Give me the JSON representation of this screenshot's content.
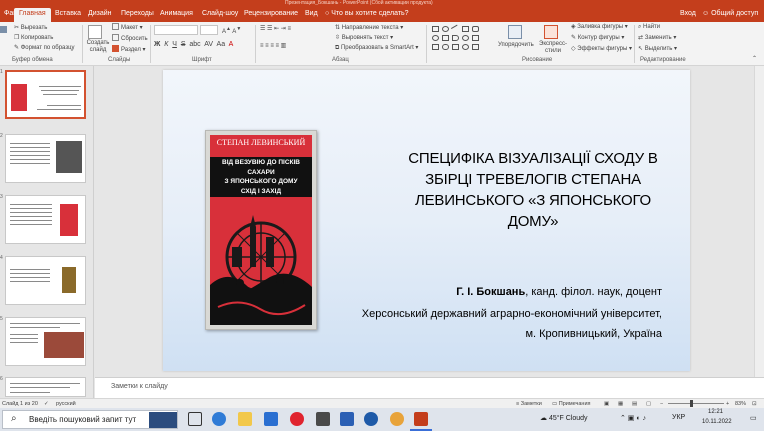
{
  "window": {
    "title": "Презентация_Бокшань - PowerPoint (Сбой активации продукта)"
  },
  "tabs": [
    "Файл",
    "Главная",
    "Вставка",
    "Дизайн",
    "Переходы",
    "Анимация",
    "Слайд-шоу",
    "Рецензирование",
    "Вид"
  ],
  "tell_me": "Что вы хотите сделать?",
  "account": {
    "signin": "Вход",
    "share": "Общий доступ"
  },
  "ribbon": {
    "clipboard": {
      "paste": "Вставить",
      "cut": "Вырезать",
      "copy": "Копировать",
      "format_painter": "Формат по образцу",
      "label": "Буфер обмена"
    },
    "slides": {
      "new_slide": "Создать слайд",
      "layout": "Макет",
      "reset": "Сбросить",
      "section": "Раздел",
      "label": "Слайды"
    },
    "font": {
      "bold": "Ж",
      "italic": "К",
      "underline": "Ч",
      "strike": "S",
      "shadow": "abc",
      "spacing": "AV",
      "case": "Aa",
      "label": "Шрифт"
    },
    "paragraph": {
      "text_direction": "Направление текста",
      "align_text": "Выровнять текст",
      "smartart": "Преобразовать в SmartArt",
      "label": "Абзац"
    },
    "drawing": {
      "arrange": "Упорядочить",
      "styles": "Экспресс-стили",
      "fill": "Заливка фигуры",
      "outline": "Контур фигуры",
      "effects": "Эффекты фигуры",
      "label": "Рисование"
    },
    "editing": {
      "find": "Найти",
      "replace": "Заменить",
      "select": "Выделить",
      "label": "Редактирование"
    }
  },
  "thumbnails": [
    {
      "num": "1"
    },
    {
      "num": "2"
    },
    {
      "num": "3"
    },
    {
      "num": "4"
    },
    {
      "num": "5"
    },
    {
      "num": "6"
    }
  ],
  "slide": {
    "cover": {
      "author": "СТЕПАН ЛЕВИНСЬКИЙ",
      "title_lines": [
        "ВІД ВЕЗУВІЮ ДО ПІСКІВ САХАРИ",
        "З ЯПОНСЬКОГО ДОМУ",
        "СХІД І ЗАХІД"
      ]
    },
    "title": "СПЕЦИФІКА ВІЗУАЛІЗАЦІЇ СХОДУ В ЗБІРЦІ ТРЕВЕЛОГІВ СТЕПАНА ЛЕВИНСЬКОГО «З ЯПОНСЬКОГО ДОМУ»",
    "author_name": "Г. І. Бокшань",
    "author_rest": ", канд. філол. наук, доцент",
    "affiliation_1": "Херсонський державний аграрно-економічний університет,",
    "affiliation_2": "м. Кропивницький, Україна"
  },
  "notes_placeholder": "Заметки к слайду",
  "status": {
    "slide_count": "Слайд 1 из 20",
    "language": "русский",
    "notes": "Заметки",
    "comments": "Примечания",
    "zoom": "83%"
  },
  "taskbar": {
    "search_placeholder": "Введіть пошуковий запит тут",
    "weather": "45°F  Cloudy",
    "lang": "УКР",
    "time": "12:21",
    "date": "10.11.2022"
  },
  "colors": {
    "accent": "#c43e1c",
    "cover_red": "#d8303a",
    "slide_bg": "#e6eef8"
  }
}
